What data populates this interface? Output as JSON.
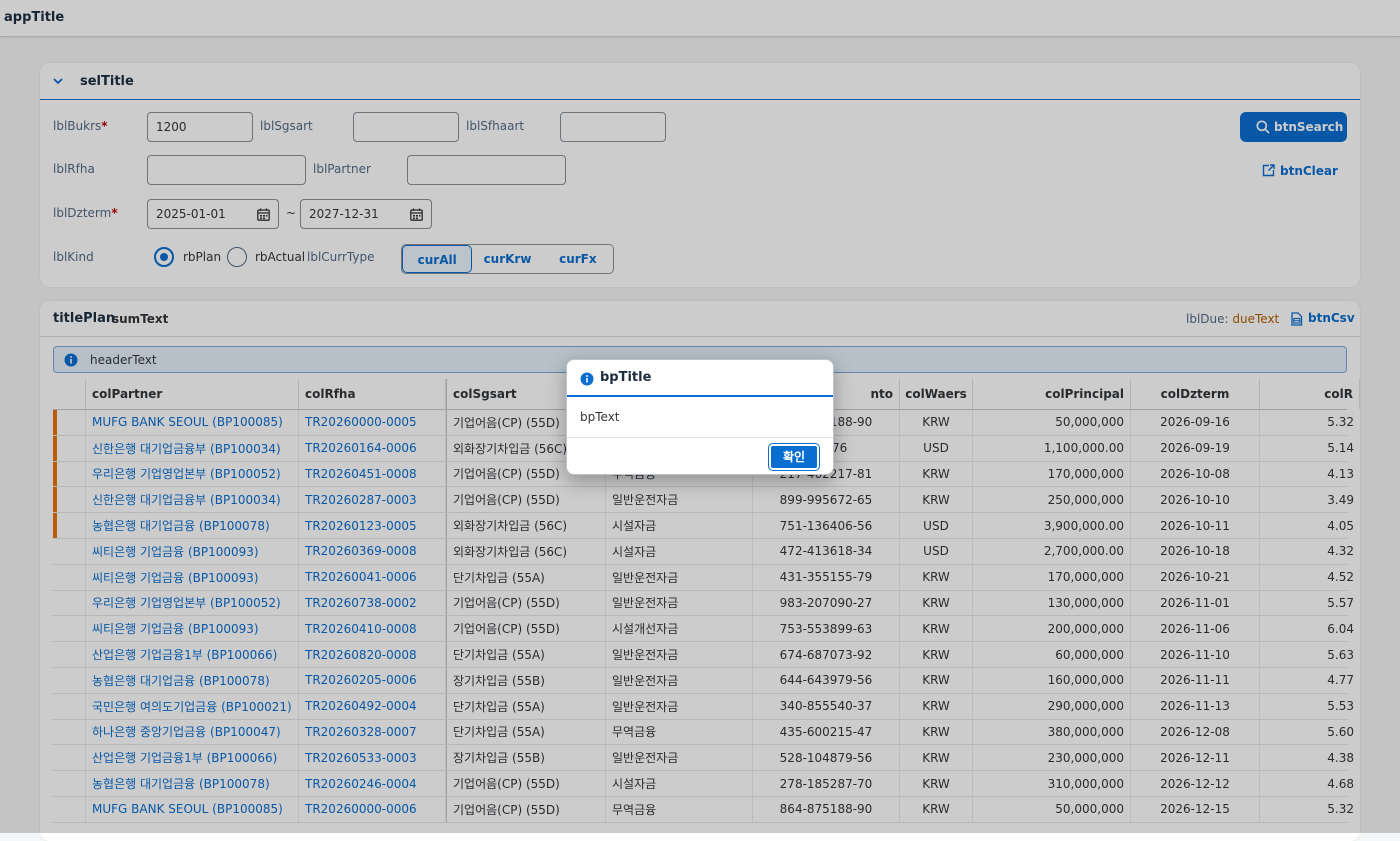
{
  "app": {
    "title": "appTitle"
  },
  "selection": {
    "title": "selTitle",
    "lbl_bukrs": "lblBukrs",
    "bukrs_value": "1200",
    "lbl_sgsart": "lblSgsart",
    "sgsart_value": "",
    "lbl_sfhaart": "lblSfhaart",
    "sfhaart_value": "",
    "lbl_rfha": "lblRfha",
    "rfha_value": "",
    "lbl_partner": "lblPartner",
    "partner_value": "",
    "lbl_dzterm": "lblDzterm",
    "date_from": "2025-01-01",
    "date_to": "2027-12-31",
    "tilde": "~",
    "lbl_kind": "lblKind",
    "rb_plan": "rbPlan",
    "rb_actual": "rbActual",
    "lbl_curr_type": "lblCurrType",
    "cur_all": "curAll",
    "cur_krw": "curKrw",
    "cur_fx": "curFx",
    "btn_search": "btnSearch",
    "btn_clear": "btnClear"
  },
  "table": {
    "title": "titlePlan",
    "sum_text": "sumText",
    "due_label": "lblDue:",
    "due_text": "dueText",
    "btn_csv": "btnCsv",
    "header_text": "headerText",
    "columns": {
      "partner": "colPartner",
      "rfha": "colRfha",
      "sgsart": "colSgsart",
      "acct": "nto",
      "waers": "colWaers",
      "principal": "colPrincipal",
      "dzterm": "colDzterm",
      "rate": "colR"
    },
    "rows": [
      {
        "flag": true,
        "partner": "MUFG BANK SEOUL (BP100085)",
        "rfha": "TR20260000-0005",
        "sgsart": "기업어음(CP) (55D)",
        "sfhaart": "",
        "acct": "864-875188-90",
        "waers": "KRW",
        "principal": "50,000,000",
        "dzterm": "2026-09-16",
        "rate": "5.32"
      },
      {
        "flag": true,
        "partner": "신한은행 대기업금융부 (BP100034)",
        "rfha": "TR20260164-0006",
        "sgsart": "외화장기차입금 (56C)",
        "sfhaart": "",
        "acct": "253-76",
        "waers": "USD",
        "principal": "1,100,000.00",
        "dzterm": "2026-09-19",
        "rate": "5.14"
      },
      {
        "flag": true,
        "partner": "우리은행 기업영업본부 (BP100052)",
        "rfha": "TR20260451-0008",
        "sgsart": "기업어음(CP) (55D)",
        "sfhaart": "무역금융",
        "acct": "217-462217-81",
        "waers": "KRW",
        "principal": "170,000,000",
        "dzterm": "2026-10-08",
        "rate": "4.13"
      },
      {
        "flag": true,
        "partner": "신한은행 대기업금융부 (BP100034)",
        "rfha": "TR20260287-0003",
        "sgsart": "기업어음(CP) (55D)",
        "sfhaart": "일반운전자금",
        "acct": "899-995672-65",
        "waers": "KRW",
        "principal": "250,000,000",
        "dzterm": "2026-10-10",
        "rate": "3.49"
      },
      {
        "flag": true,
        "partner": "농협은행 대기업금융 (BP100078)",
        "rfha": "TR20260123-0005",
        "sgsart": "외화장기차입금 (56C)",
        "sfhaart": "시설자금",
        "acct": "751-136406-56",
        "waers": "USD",
        "principal": "3,900,000.00",
        "dzterm": "2026-10-11",
        "rate": "4.05"
      },
      {
        "flag": false,
        "partner": "씨티은행 기업금융 (BP100093)",
        "rfha": "TR20260369-0008",
        "sgsart": "외화장기차입금 (56C)",
        "sfhaart": "시설자금",
        "acct": "472-413618-34",
        "waers": "USD",
        "principal": "2,700,000.00",
        "dzterm": "2026-10-18",
        "rate": "4.32"
      },
      {
        "flag": false,
        "partner": "씨티은행 기업금융 (BP100093)",
        "rfha": "TR20260041-0006",
        "sgsart": "단기차입금 (55A)",
        "sfhaart": "일반운전자금",
        "acct": "431-355155-79",
        "waers": "KRW",
        "principal": "170,000,000",
        "dzterm": "2026-10-21",
        "rate": "4.52"
      },
      {
        "flag": false,
        "partner": "우리은행 기업영업본부 (BP100052)",
        "rfha": "TR20260738-0002",
        "sgsart": "기업어음(CP) (55D)",
        "sfhaart": "일반운전자금",
        "acct": "983-207090-27",
        "waers": "KRW",
        "principal": "130,000,000",
        "dzterm": "2026-11-01",
        "rate": "5.57"
      },
      {
        "flag": false,
        "partner": "씨티은행 기업금융 (BP100093)",
        "rfha": "TR20260410-0008",
        "sgsart": "기업어음(CP) (55D)",
        "sfhaart": "시설개선자금",
        "acct": "753-553899-63",
        "waers": "KRW",
        "principal": "200,000,000",
        "dzterm": "2026-11-06",
        "rate": "6.04"
      },
      {
        "flag": false,
        "partner": "산업은행 기업금융1부 (BP100066)",
        "rfha": "TR20260820-0008",
        "sgsart": "단기차입금 (55A)",
        "sfhaart": "일반운전자금",
        "acct": "674-687073-92",
        "waers": "KRW",
        "principal": "60,000,000",
        "dzterm": "2026-11-10",
        "rate": "5.63"
      },
      {
        "flag": false,
        "partner": "농협은행 대기업금융 (BP100078)",
        "rfha": "TR20260205-0006",
        "sgsart": "장기차입금 (55B)",
        "sfhaart": "일반운전자금",
        "acct": "644-643979-56",
        "waers": "KRW",
        "principal": "160,000,000",
        "dzterm": "2026-11-11",
        "rate": "4.77"
      },
      {
        "flag": false,
        "partner": "국민은행 여의도기업금융 (BP100021)",
        "rfha": "TR20260492-0004",
        "sgsart": "단기차입금 (55A)",
        "sfhaart": "일반운전자금",
        "acct": "340-855540-37",
        "waers": "KRW",
        "principal": "290,000,000",
        "dzterm": "2026-11-13",
        "rate": "5.53"
      },
      {
        "flag": false,
        "partner": "하나은행 중앙기업금융 (BP100047)",
        "rfha": "TR20260328-0007",
        "sgsart": "단기차입금 (55A)",
        "sfhaart": "무역금융",
        "acct": "435-600215-47",
        "waers": "KRW",
        "principal": "380,000,000",
        "dzterm": "2026-12-08",
        "rate": "5.60"
      },
      {
        "flag": false,
        "partner": "산업은행 기업금융1부 (BP100066)",
        "rfha": "TR20260533-0003",
        "sgsart": "장기차입금 (55B)",
        "sfhaart": "일반운전자금",
        "acct": "528-104879-56",
        "waers": "KRW",
        "principal": "230,000,000",
        "dzterm": "2026-12-11",
        "rate": "4.38"
      },
      {
        "flag": false,
        "partner": "농협은행 대기업금융 (BP100078)",
        "rfha": "TR20260246-0004",
        "sgsart": "기업어음(CP) (55D)",
        "sfhaart": "시설자금",
        "acct": "278-185287-70",
        "waers": "KRW",
        "principal": "310,000,000",
        "dzterm": "2026-12-12",
        "rate": "4.68"
      },
      {
        "flag": false,
        "partner": "MUFG BANK SEOUL (BP100085)",
        "rfha": "TR20260000-0006",
        "sgsart": "기업어음(CP) (55D)",
        "sfhaart": "무역금융",
        "acct": "864-875188-90",
        "waers": "KRW",
        "principal": "50,000,000",
        "dzterm": "2026-12-15",
        "rate": "5.32"
      }
    ]
  },
  "dialog": {
    "title": "bpTitle",
    "text": "bpText",
    "ok_label": "확인"
  },
  "colors": {
    "accent": "#0a6ed1",
    "warning_flag": "#e9730c",
    "due_text": "#b05e00"
  }
}
